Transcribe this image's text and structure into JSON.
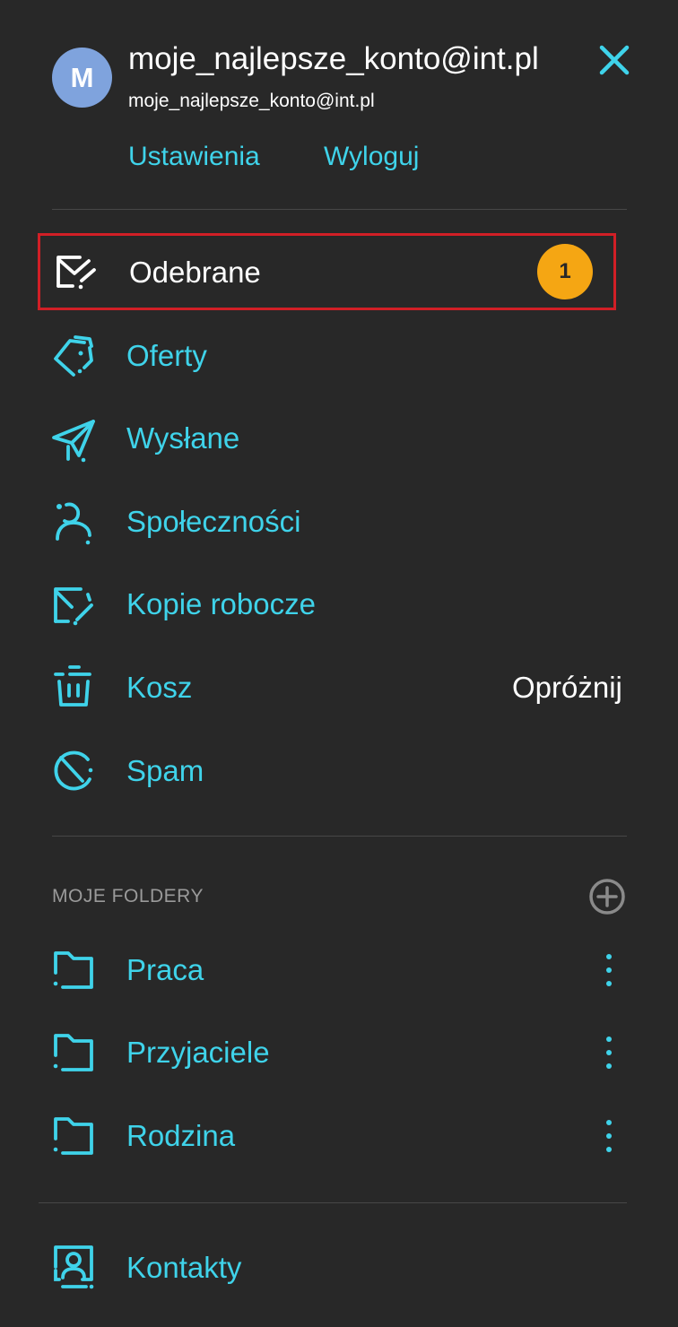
{
  "account": {
    "avatar_letter": "M",
    "title": "moje_najlepsze_konto@int.pl",
    "email": "moje_najlepsze_konto@int.pl",
    "settings_label": "Ustawienia",
    "logout_label": "Wyloguj"
  },
  "menu": {
    "inbox": {
      "label": "Odebrane",
      "badge": "1",
      "icon": "inbox-icon"
    },
    "offers": {
      "label": "Oferty",
      "icon": "tag-icon"
    },
    "sent": {
      "label": "Wysłane",
      "icon": "paper-plane-icon"
    },
    "social": {
      "label": "Społeczności",
      "icon": "people-icon"
    },
    "drafts": {
      "label": "Kopie robocze",
      "icon": "draft-icon"
    },
    "trash": {
      "label": "Kosz",
      "action_label": "Opróżnij",
      "icon": "trash-icon"
    },
    "spam": {
      "label": "Spam",
      "icon": "spam-icon"
    }
  },
  "folders": {
    "section_title": "MOJE FOLDERY",
    "items": [
      {
        "label": "Praca"
      },
      {
        "label": "Przyjaciele"
      },
      {
        "label": "Rodzina"
      }
    ]
  },
  "contacts": {
    "label": "Kontakty",
    "icon": "contacts-icon"
  },
  "colors": {
    "background": "#282828",
    "accent": "#3fd3ea",
    "badge": "#f5a613",
    "highlight_border": "#d11f26",
    "avatar": "#7fa3dd"
  }
}
